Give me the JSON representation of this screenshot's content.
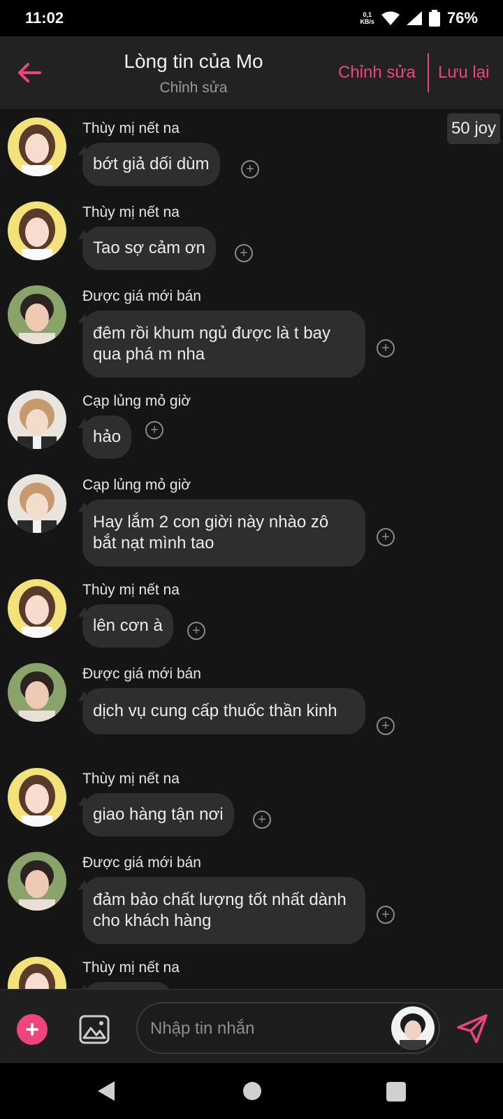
{
  "status": {
    "time": "11:02",
    "speed_value": "0,1",
    "speed_unit": "KB/s",
    "battery": "76%"
  },
  "header": {
    "title": "Lòng tin của Mo",
    "subtitle": "Chỉnh sửa",
    "edit_label": "Chỉnh sửa",
    "save_label": "Lưu lại"
  },
  "joy_badge": "50 joy",
  "messages": [
    {
      "sender": "Thùy mị nết na",
      "text": "bớt giả dối dùm",
      "avatar": "girl-avatar"
    },
    {
      "sender": "Thùy mị nết na",
      "text": "Tao sợ cảm ơn",
      "avatar": "girl-avatar"
    },
    {
      "sender": "Được giá mới bán",
      "text": "đêm rồi khum ngủ được là t bay qua phá m nha",
      "avatar": "boy-avatar"
    },
    {
      "sender": "Cạp lủng mỏ giờ",
      "text": "hảo",
      "avatar": "blonde-avatar"
    },
    {
      "sender": "Cạp lủng mỏ giờ",
      "text": "Hay lắm 2 con giời này nhào zô bắt nạt mình tao",
      "avatar": "blonde-avatar"
    },
    {
      "sender": "Thùy mị nết na",
      "text": "lên cơn à",
      "avatar": "girl-avatar"
    },
    {
      "sender": "Được giá mới bán",
      "text": "dịch vụ cung cấp thuốc thần kinh",
      "avatar": "boy-avatar"
    },
    {
      "sender": "Thùy mị nết na",
      "text": "giao hàng tận nơi",
      "avatar": "girl-avatar"
    },
    {
      "sender": "Được giá mới bán",
      "text": "đảm bảo chất lượng tốt nhất dành cho khách hàng",
      "avatar": "boy-avatar"
    },
    {
      "sender": "Thùy mị nết na",
      "text": "",
      "avatar": "girl-avatar"
    }
  ],
  "input": {
    "placeholder": "Nhập tin nhắn"
  },
  "colors": {
    "accent": "#f0457c",
    "background": "#151515",
    "bubble": "#2e2e2e",
    "header": "#222222"
  },
  "icons": {
    "back": "arrow-left-icon",
    "add": "plus-icon",
    "image": "image-icon",
    "send": "send-icon",
    "react": "add-reaction-icon"
  }
}
